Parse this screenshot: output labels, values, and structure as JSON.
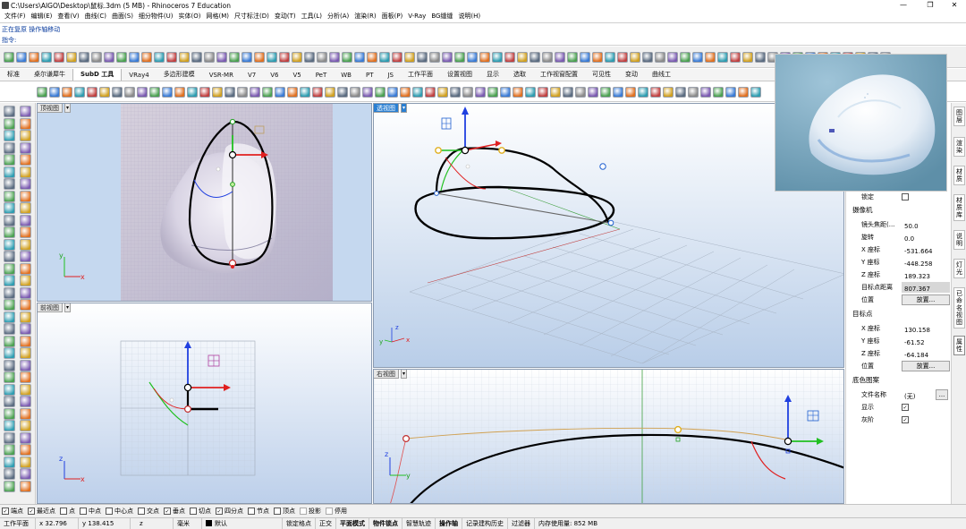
{
  "window": {
    "title": "C:\\Users\\AIGO\\Desktop\\鼠标.3dm (5 MB) - Rhinoceros 7 Education",
    "minimize": "—",
    "restore": "❐",
    "close": "✕"
  },
  "menu": [
    "文件(F)",
    "编辑(E)",
    "查看(V)",
    "曲线(C)",
    "曲面(S)",
    "细分物件(U)",
    "实体(O)",
    "网格(M)",
    "尺寸标注(D)",
    "变动(T)",
    "工具(L)",
    "分析(A)",
    "渲染(R)",
    "面板(P)",
    "V-Ray",
    "BG缝缝",
    "说明(H)"
  ],
  "command": {
    "history": "正在复原 操作轴移动",
    "prompt": "指令:"
  },
  "tabs": [
    {
      "label": "标准",
      "active": false
    },
    {
      "label": "桌尔谦犀牛",
      "active": false
    },
    {
      "label": "SubD 工具",
      "active": true
    },
    {
      "label": "VRay4",
      "active": false
    },
    {
      "label": "多边形建模",
      "active": false
    },
    {
      "label": "VSR-MR",
      "active": false
    },
    {
      "label": "V7",
      "active": false
    },
    {
      "label": "V6",
      "active": false
    },
    {
      "label": "V5",
      "active": false
    },
    {
      "label": "PeT",
      "active": false
    },
    {
      "label": "WB",
      "active": false
    },
    {
      "label": "PT",
      "active": false
    },
    {
      "label": "JS",
      "active": false
    },
    {
      "label": "工作平面",
      "active": false
    },
    {
      "label": "设置视图",
      "active": false
    },
    {
      "label": "显示",
      "active": false
    },
    {
      "label": "选取",
      "active": false
    },
    {
      "label": "工作视窗配置",
      "active": false
    },
    {
      "label": "可见性",
      "active": false
    },
    {
      "label": "变动",
      "active": false
    },
    {
      "label": "曲线工",
      "active": false
    }
  ],
  "viewports": {
    "top": "顶视图",
    "front": "前视图",
    "perspective": "透视图",
    "right": "右视图"
  },
  "axes": {
    "x": "x",
    "y": "y",
    "z": "z"
  },
  "properties": {
    "lock_label": "锁定",
    "camera_header": "摄像机",
    "lens_label": "镜头焦距(...",
    "lens_value": "50.0",
    "rotation_label": "旋转",
    "rotation_value": "0.0",
    "cam_x_label": "X 座标",
    "cam_x_value": "-531.664",
    "cam_y_label": "Y 座标",
    "cam_y_value": "-448.258",
    "cam_z_label": "Z 座标",
    "cam_z_value": "189.323",
    "target_dist_label": "目标点距离",
    "target_dist_value": "807.367",
    "position_label": "位置",
    "place_button": "放置...",
    "target_header": "目标点",
    "tgt_x_label": "X 座标",
    "tgt_x_value": "130.158",
    "tgt_y_label": "Y 座标",
    "tgt_y_value": "-61.52",
    "tgt_z_label": "Z 座标",
    "tgt_z_value": "-64.184",
    "tgt_position_label": "位置",
    "tgt_place_button": "放置...",
    "wallpaper_header": "底色图案",
    "filename_label": "文件名称",
    "filename_value": "(无)",
    "browse_button": "...",
    "show_label": "显示",
    "gray_label": "灰阶"
  },
  "side_tabs": [
    "图层",
    "渲染",
    "材质",
    "材质库",
    "说明",
    "灯光",
    "已命名视图",
    "属性"
  ],
  "osnaps": [
    {
      "label": "端点",
      "checked": true
    },
    {
      "label": "最近点",
      "checked": true
    },
    {
      "label": "点",
      "checked": false
    },
    {
      "label": "中点",
      "checked": false
    },
    {
      "label": "中心点",
      "checked": false
    },
    {
      "label": "交点",
      "checked": false
    },
    {
      "label": "垂点",
      "checked": true
    },
    {
      "label": "切点",
      "checked": false
    },
    {
      "label": "四分点",
      "checked": true
    },
    {
      "label": "节点",
      "checked": false
    },
    {
      "label": "顶点",
      "checked": false
    },
    {
      "label": "投影",
      "checked": false
    },
    {
      "label": "停用",
      "checked": false
    }
  ],
  "status": {
    "cplane": "工作平面",
    "x": "x 32.796",
    "y": "y 138.415",
    "z": "z",
    "units": "毫米",
    "layer": "默认",
    "grid_snap": "锁定格点",
    "ortho": "正交",
    "planar": "平面模式",
    "osnap": "物件锁点",
    "smarttrack": "智慧轨迹",
    "gumball": "操作轴",
    "history": "记录建构历史",
    "filter": "过滤器",
    "memory": "内存使用量: 852 MB"
  },
  "colors": {
    "viewport_bg": "#c5d8ef",
    "active_blue": "#2a7fd2",
    "axis_red": "#e02020",
    "axis_green": "#20c020",
    "axis_blue": "#2040e0"
  }
}
